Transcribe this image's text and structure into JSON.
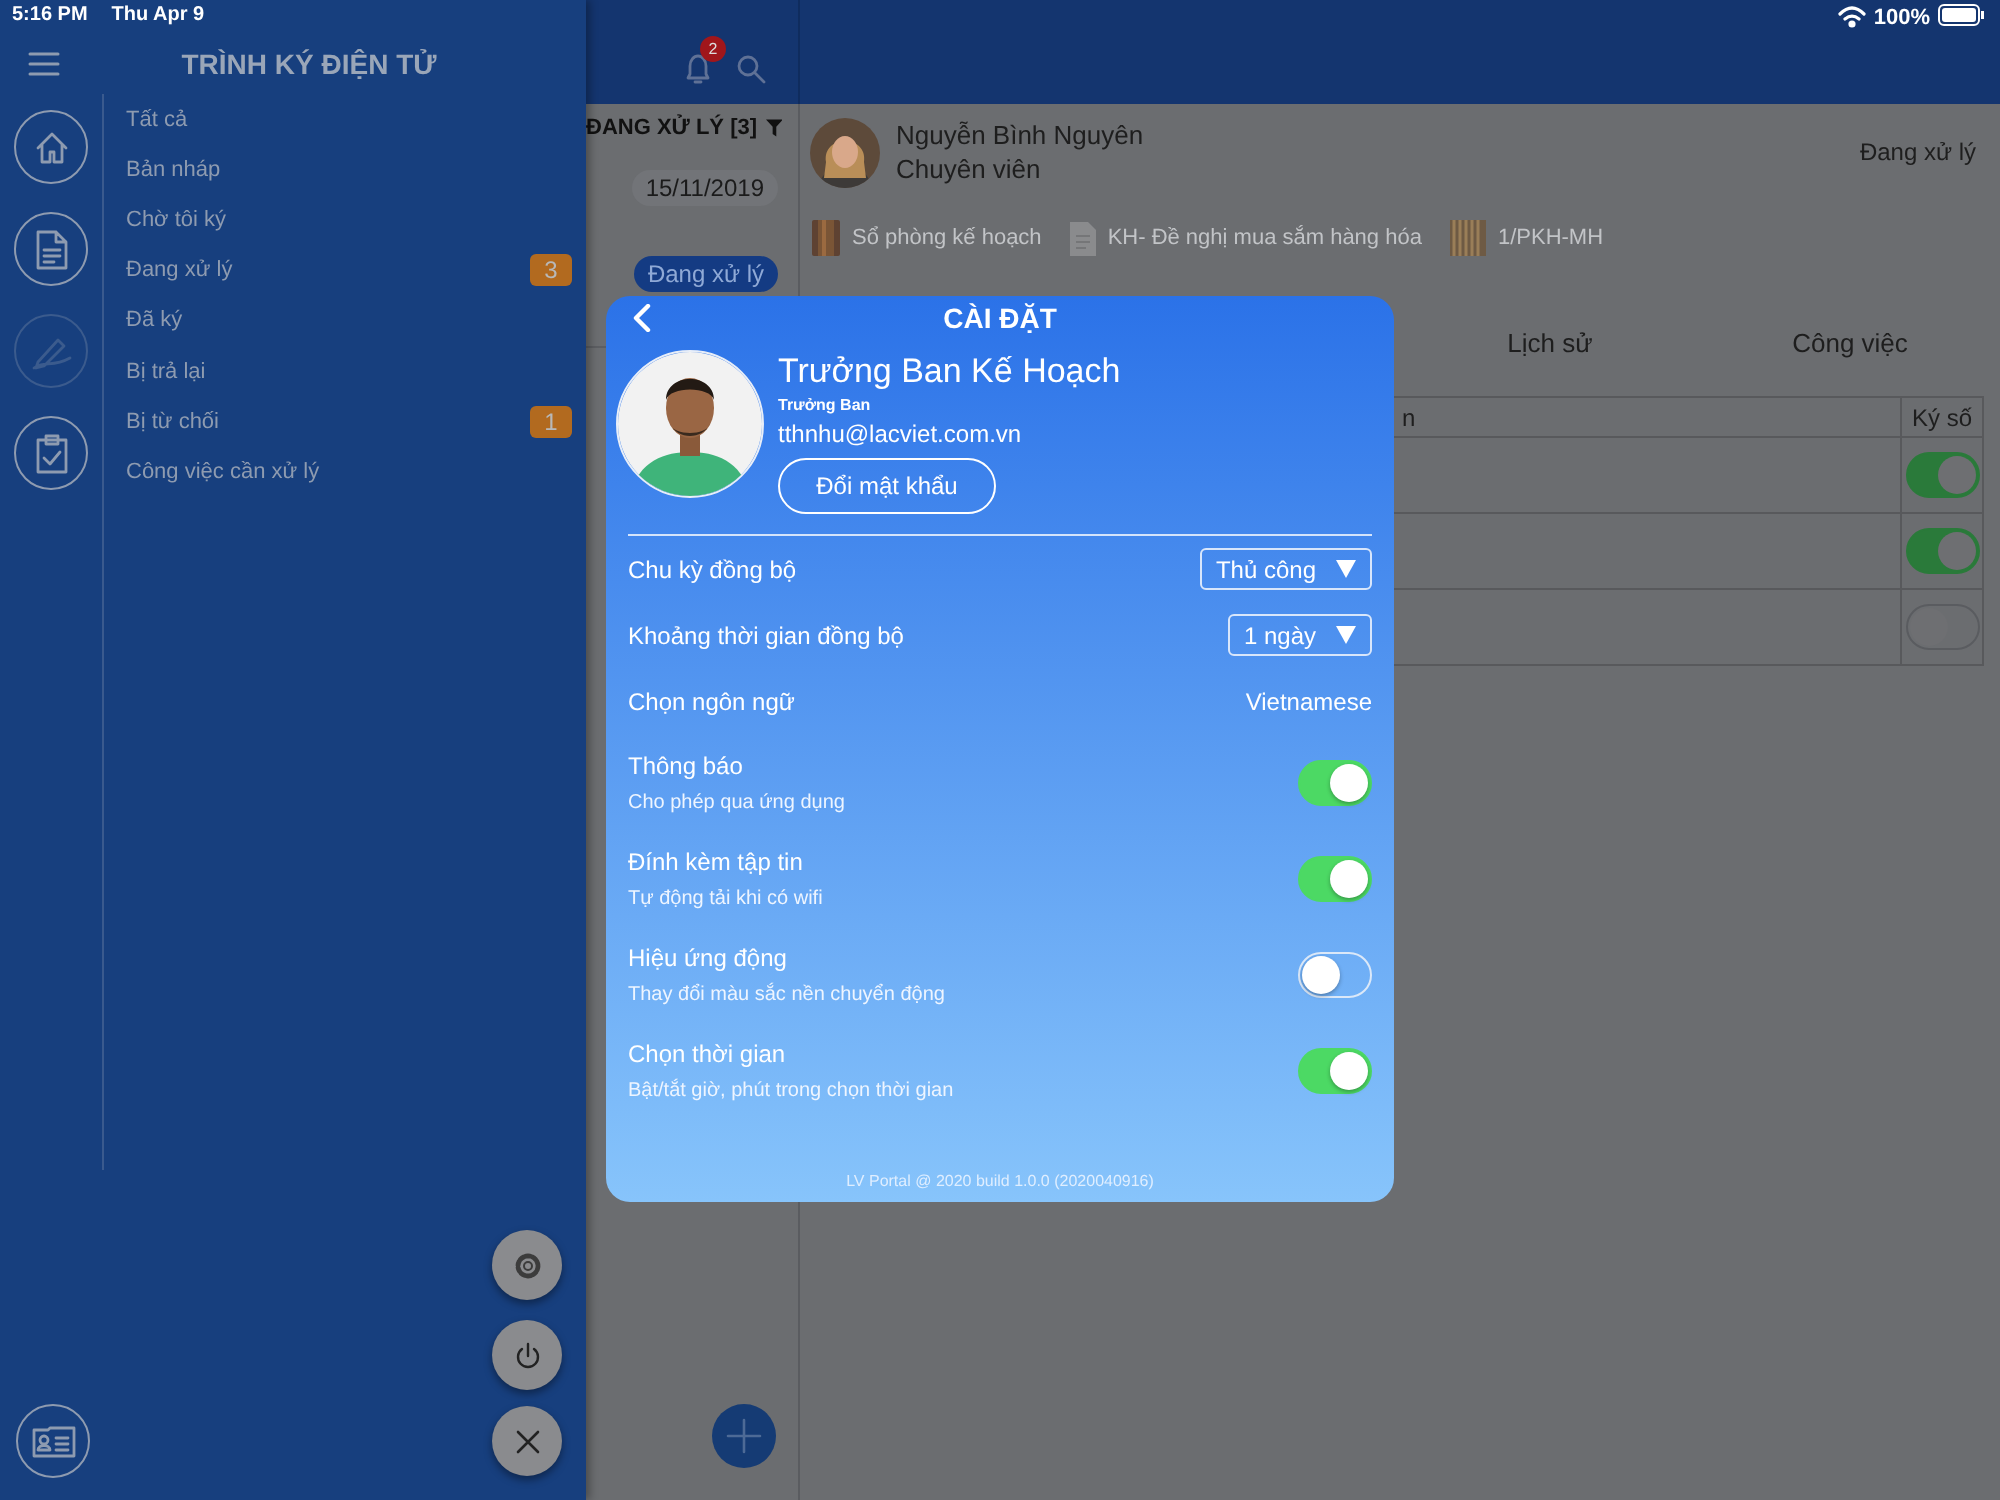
{
  "status_bar": {
    "time": "5:16 PM",
    "date": "Thu Apr 9",
    "battery": "100%"
  },
  "drawer": {
    "title": "TRÌNH KÝ ĐIỆN TỬ",
    "items": [
      {
        "label": "Tất cả"
      },
      {
        "label": "Bản nháp"
      },
      {
        "label": "Chờ tôi ký"
      },
      {
        "label": "Đang xử lý",
        "badge": "3"
      },
      {
        "label": "Đã ký"
      },
      {
        "label": "Bị trả lại"
      },
      {
        "label": "Bị từ chối",
        "badge": "1"
      },
      {
        "label": "Công việc cần xử lý"
      }
    ]
  },
  "header": {
    "notification_count": "2"
  },
  "list": {
    "heading": "ĐANG XỬ LÝ [3]",
    "date": "15/11/2019",
    "status": "Đang xử lý"
  },
  "detail": {
    "sender_name": "Nguyễn Bình Nguyên",
    "sender_role": "Chuyên viên",
    "status": "Đang xử lý",
    "attachments": [
      {
        "kind": "book",
        "label": "Sổ phòng kế hoạch"
      },
      {
        "kind": "document",
        "label": "KH- Đề nghị mua sắm hàng hóa"
      },
      {
        "kind": "binder",
        "label": "1/PKH-MH"
      }
    ],
    "tabs": [
      {
        "label": "Lịch sử"
      },
      {
        "label": "Công việc"
      }
    ],
    "table": {
      "columns": [
        "n",
        "Ký số"
      ],
      "rows": [
        {
          "signed": true
        },
        {
          "signed": true
        },
        {
          "signed": false
        }
      ]
    }
  },
  "settings": {
    "title": "CÀI ĐẶT",
    "user": {
      "name": "Trưởng Ban Kế Hoạch",
      "role": "Trưởng Ban",
      "email": "tthnhu@lacviet.com.vn"
    },
    "change_password": "Đổi mật khẩu",
    "options": [
      {
        "kind": "dropdown",
        "label": "Chu kỳ đồng bộ",
        "value": "Thủ công"
      },
      {
        "kind": "dropdown",
        "label": "Khoảng thời gian đồng bộ",
        "value": "1 ngày"
      },
      {
        "kind": "text",
        "label": "Chọn ngôn ngữ",
        "value": "Vietnamese"
      }
    ],
    "toggles": [
      {
        "label": "Thông báo",
        "description": "Cho phép qua ứng dụng",
        "on": true
      },
      {
        "label": "Đính kèm tập tin",
        "description": "Tự động tải khi có wifi",
        "on": true
      },
      {
        "label": "Hiệu ứng động",
        "description": "Thay đổi màu sắc nền chuyển động",
        "on": false
      },
      {
        "label": "Chọn thời gian",
        "description": "Bật/tắt giờ, phút trong chọn thời gian",
        "on": true
      }
    ],
    "footer": "LV Portal @ 2020 build 1.0.0 (2020040916)"
  }
}
